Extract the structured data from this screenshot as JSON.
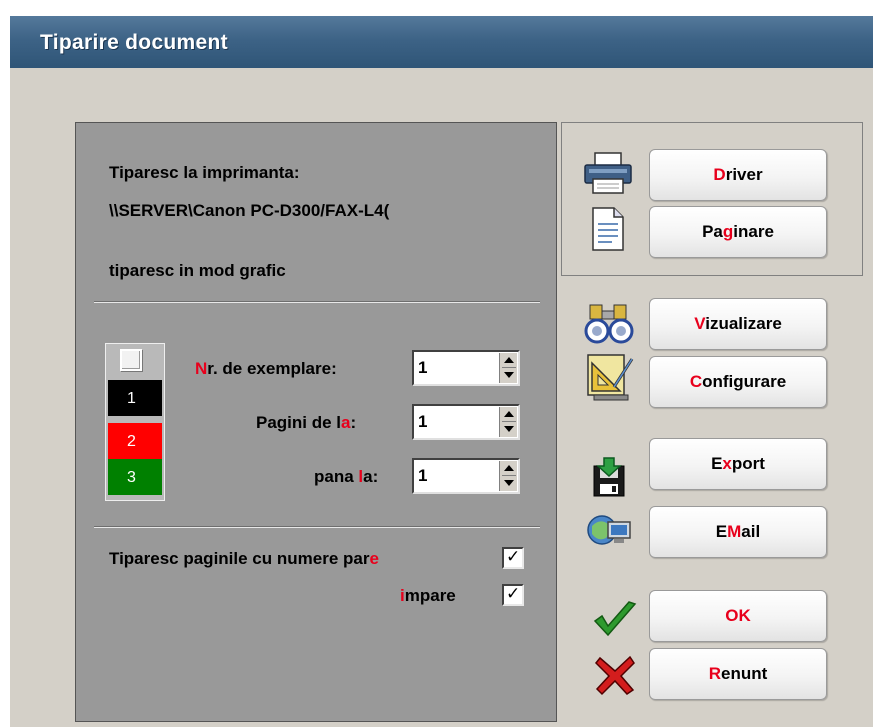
{
  "window": {
    "title": "Tiparire document"
  },
  "printer": {
    "line1": "Tiparesc la imprimanta:",
    "path": "\\\\SERVER\\Canon PC-D300/FAX-L4(",
    "mode": "tiparesc in mod grafic"
  },
  "colors": {
    "swatches": [
      {
        "label": "1",
        "color": "#000000"
      },
      {
        "label": "2",
        "color": "#ff0000"
      },
      {
        "label": "3",
        "color": "#008000"
      }
    ],
    "accent": "#e8001c",
    "panel": "#999999",
    "window": "#d4d0c8"
  },
  "fields": {
    "copies": {
      "hot": "N",
      "rest": "r. de exemplare:",
      "value": "1"
    },
    "from_page": {
      "pre": "Pagini de l",
      "hot": "a",
      "post": ":",
      "value": "1"
    },
    "to_page": {
      "pre": "pana ",
      "hot": "l",
      "post": "a:",
      "value": "1"
    }
  },
  "options": {
    "even": {
      "pre": "Tiparesc paginile cu numere par",
      "hot": "e",
      "checked": "✓"
    },
    "odd": {
      "hot": "i",
      "rest": "mpare",
      "checked": "✓"
    }
  },
  "buttons": {
    "driver": {
      "hot": "D",
      "rest": "river",
      "icon": "printer-icon"
    },
    "paginare": {
      "pre": "Pa",
      "hot": "g",
      "rest": "inare",
      "icon": "document-icon"
    },
    "vizualizare": {
      "hot": "V",
      "rest": "izualizare",
      "icon": "binoculars-icon"
    },
    "configurare": {
      "hot": "C",
      "rest": "onfigurare",
      "icon": "setsquare-icon"
    },
    "export": {
      "pre": "E",
      "hot": "x",
      "rest": "port",
      "icon": "floppy-export-icon"
    },
    "email": {
      "pre": "E",
      "hot": "M",
      "rest": "ail",
      "icon": "network-globe-icon"
    },
    "ok": {
      "hot": "O",
      "rest": "K",
      "icon": "checkmark-icon"
    },
    "renunt": {
      "hot": "R",
      "rest": "enunt",
      "icon": "cross-icon"
    }
  }
}
